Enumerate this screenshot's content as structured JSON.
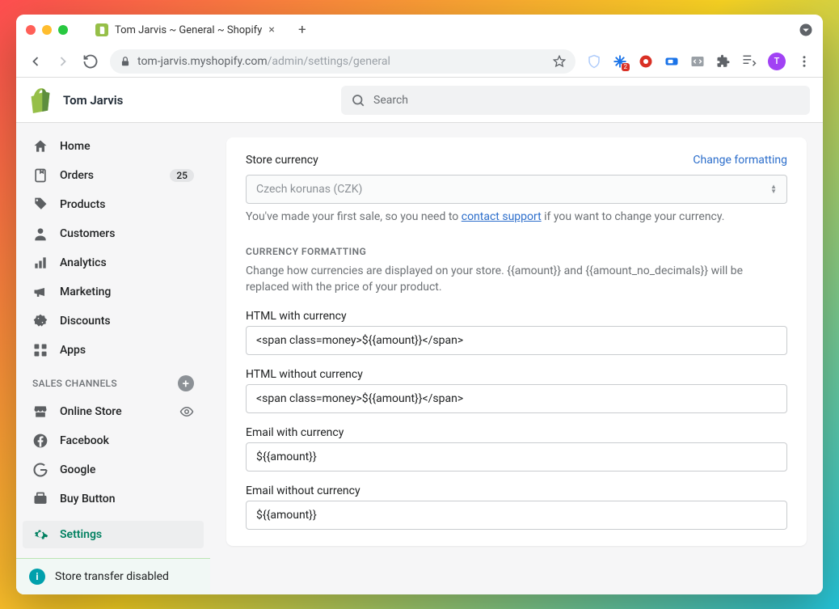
{
  "browser": {
    "tab_title": "Tom Jarvis ~ General ~ Shopify",
    "url_host": "tom-jarvis.myshopify.com",
    "url_path": "/admin/settings/general",
    "extensions_badge": "2",
    "avatar_letter": "T"
  },
  "header": {
    "shop_name": "Tom Jarvis",
    "search_placeholder": "Search"
  },
  "sidebar": {
    "items": [
      {
        "label": "Home"
      },
      {
        "label": "Orders",
        "badge": "25"
      },
      {
        "label": "Products"
      },
      {
        "label": "Customers"
      },
      {
        "label": "Analytics"
      },
      {
        "label": "Marketing"
      },
      {
        "label": "Discounts"
      },
      {
        "label": "Apps"
      }
    ],
    "channels_head": "SALES CHANNELS",
    "channels": [
      {
        "label": "Online Store"
      },
      {
        "label": "Facebook"
      },
      {
        "label": "Google"
      },
      {
        "label": "Buy Button"
      }
    ],
    "settings_label": "Settings",
    "notice": "Store transfer disabled"
  },
  "main": {
    "store_currency_label": "Store currency",
    "change_formatting": "Change formatting",
    "currency_select": "Czech korunas (CZK)",
    "currency_help_pre": "You've made your first sale, so you need to ",
    "currency_help_link": "contact support",
    "currency_help_post": " if you want to change your currency.",
    "formatting_head": "CURRENCY FORMATTING",
    "formatting_desc": "Change how currencies are displayed on your store. {{amount}} and {{amount_no_decimals}} will be replaced with the price of your product.",
    "fields": {
      "html_with_label": "HTML with currency",
      "html_with_value": "<span class=money>${{amount}}</span>",
      "html_without_label": "HTML without currency",
      "html_without_value": "<span class=money>${{amount}}</span>",
      "email_with_label": "Email with currency",
      "email_with_value": "${{amount}}",
      "email_without_label": "Email without currency",
      "email_without_value": "${{amount}}"
    }
  }
}
